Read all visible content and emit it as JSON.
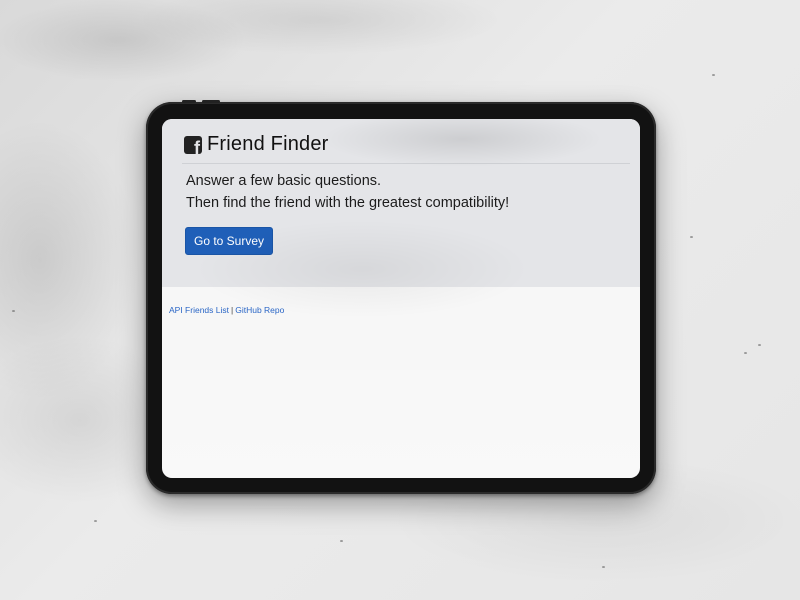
{
  "app": {
    "brand_title": "Friend Finder",
    "brand_icon": "facebook-square-icon"
  },
  "hero": {
    "line1": "Answer a few basic questions.",
    "line2": "Then find the friend with the greatest compatibility!",
    "cta_label": "Go to Survey"
  },
  "footer": {
    "links": [
      {
        "label": "API Friends List"
      },
      {
        "label": "GitHub Repo"
      }
    ],
    "separator": "|"
  },
  "colors": {
    "primary": "#1f5fb8",
    "link": "#2a66c6",
    "jumbotron_bg": "#e4e5e8",
    "device_bezel": "#121212"
  }
}
